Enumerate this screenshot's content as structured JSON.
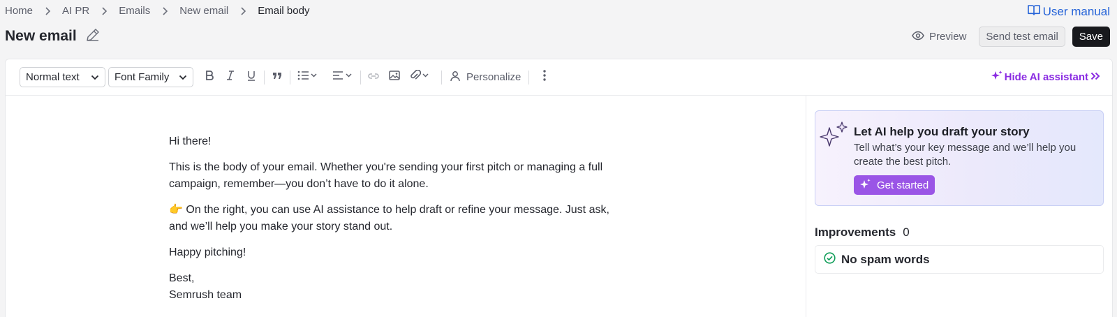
{
  "breadcrumb": [
    "Home",
    "AI PR",
    "Emails",
    "New email",
    "Email body"
  ],
  "user_manual": "User manual",
  "page_title": "New email",
  "actions": {
    "preview": "Preview",
    "send_test": "Send test email",
    "save": "Save"
  },
  "toolbar": {
    "text_style": "Normal text",
    "font_family": "Font Family",
    "personalize": "Personalize",
    "hide_ai": "Hide AI assistant"
  },
  "email": {
    "greeting": "Hi there!",
    "para1": "This is the body of your email. Whether you're sending your first pitch or managing a full campaign, remember—you don’t have to do it alone.",
    "para2_emoji": "👉",
    "para2": " On the right, you can use AI assistance to help draft or refine your message. Just ask, and we’ll help you make your story stand out.",
    "para3": "Happy pitching!",
    "signoff": "Best,",
    "signature": "Semrush team"
  },
  "ai_panel": {
    "title": "Let AI help you draft your story",
    "description": "Tell what’s your key message and we’ll help you create the best pitch.",
    "button": "Get started"
  },
  "improvements": {
    "label": "Improvements",
    "count": "0",
    "items": [
      "No spam words"
    ]
  },
  "colors": {
    "accent_purple": "#8a2be2",
    "link_blue": "#2563d8",
    "success_green": "#0f9d58",
    "primary_dark": "#18191d"
  }
}
